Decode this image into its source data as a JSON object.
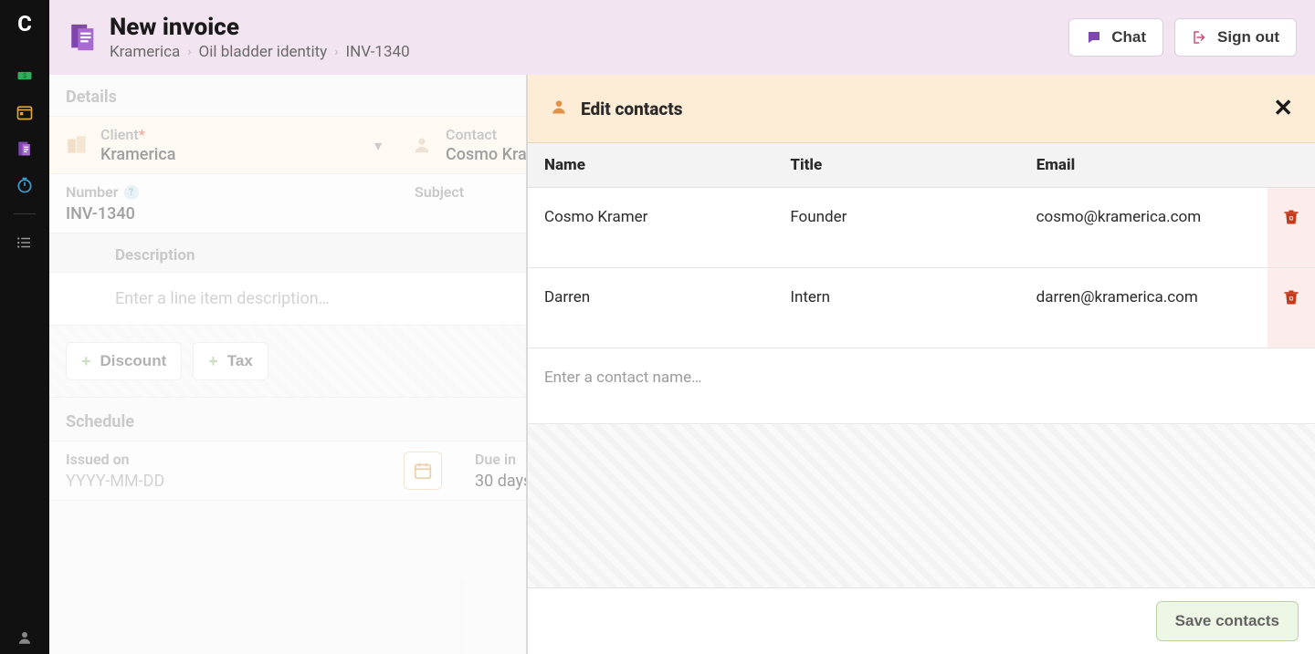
{
  "app": {
    "logo_letter": "C"
  },
  "header": {
    "title": "New invoice",
    "breadcrumbs": [
      "Kramerica",
      "Oil bladder identity",
      "INV-1340"
    ],
    "buttons": {
      "chat": "Chat",
      "sign_out": "Sign out"
    }
  },
  "details": {
    "section_label": "Details",
    "client": {
      "label": "Client",
      "required": true,
      "value": "Kramerica"
    },
    "contact": {
      "label": "Contact",
      "value": "Cosmo Kramer"
    },
    "number": {
      "label": "Number",
      "value": "INV-1340"
    },
    "subject": {
      "label": "Subject",
      "value": ""
    },
    "description": {
      "label": "Description",
      "placeholder": "Enter a line item description…"
    },
    "addons": {
      "discount": "Discount",
      "tax": "Tax"
    }
  },
  "schedule": {
    "section_label": "Schedule",
    "issued": {
      "label": "Issued on",
      "placeholder": "YYYY-MM-DD"
    },
    "due": {
      "label": "Due in",
      "value": "30 days"
    }
  },
  "panel": {
    "title": "Edit contacts",
    "columns": {
      "name": "Name",
      "title": "Title",
      "email": "Email"
    },
    "contacts": [
      {
        "name": "Cosmo Kramer",
        "title": "Founder",
        "email": "cosmo@kramerica.com"
      },
      {
        "name": "Darren",
        "title": "Intern",
        "email": "darren@kramerica.com"
      }
    ],
    "new_placeholder": "Enter a contact name…",
    "save_label": "Save contacts"
  }
}
